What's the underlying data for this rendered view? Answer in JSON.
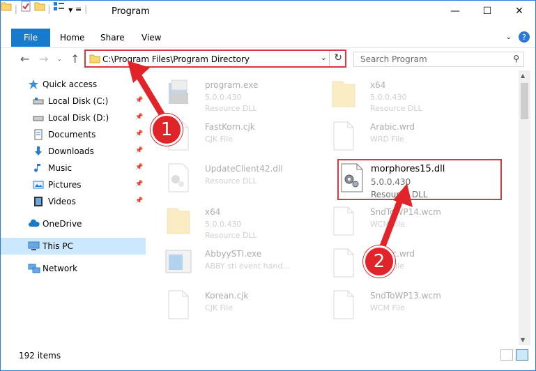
{
  "window": {
    "title": "Program"
  },
  "ribbon": {
    "tabs": [
      "File",
      "Home",
      "Share",
      "View"
    ]
  },
  "navbar": {
    "address_path": "C:\\Program Files\\Program Directory",
    "search_placeholder": "Search Program"
  },
  "sidebar": {
    "items": [
      {
        "label": "Quick access",
        "icon": "star-icon"
      },
      {
        "label": "Local Disk (C:)",
        "icon": "drive-icon"
      },
      {
        "label": "Local Disk (D:)",
        "icon": "drive-icon"
      },
      {
        "label": "Documents",
        "icon": "documents-icon"
      },
      {
        "label": "Downloads",
        "icon": "download-icon"
      },
      {
        "label": "Music",
        "icon": "music-icon"
      },
      {
        "label": "Pictures",
        "icon": "pictures-icon"
      },
      {
        "label": "Videos",
        "icon": "videos-icon"
      },
      {
        "label": "OneDrive",
        "icon": "cloud-icon"
      },
      {
        "label": "This PC",
        "icon": "computer-icon"
      },
      {
        "label": "Network",
        "icon": "network-icon"
      }
    ]
  },
  "files": [
    {
      "name": "program.exe",
      "line2": "5.0.0.430",
      "line3": "Resource DLL",
      "icon": "installer-icon"
    },
    {
      "name": "x64",
      "line2": "5.0.0.430",
      "line3": "Resource DLL",
      "icon": "folder-icon"
    },
    {
      "name": "FastKorn.cjk",
      "line2": "CJK File",
      "line3": "",
      "icon": "blank-file-icon"
    },
    {
      "name": "Arabic.wrd",
      "line2": "WRD File",
      "line3": "",
      "icon": "blank-file-icon"
    },
    {
      "name": "UpdateClient42.dll",
      "line2": "Resource DLL",
      "line3": "",
      "icon": "dll-gear-icon"
    },
    {
      "name": "morphores15.dll",
      "line2": "5.0.0.430",
      "line3": "Resource DLL",
      "icon": "dll-gear-icon"
    },
    {
      "name": "x64",
      "line2": "5.0.0.430",
      "line3": "Resource DLL",
      "icon": "folder-icon"
    },
    {
      "name": "SndToWP14.wcm",
      "line2": "WCM File",
      "line3": "",
      "icon": "blank-file-icon"
    },
    {
      "name": "AbbyySTI.exe",
      "line2": "ABBY sti event hand...",
      "line3": "",
      "icon": "app-window-icon"
    },
    {
      "name": "Arabic.wrd",
      "line2": "WRD File",
      "line3": "",
      "icon": "blank-file-icon"
    },
    {
      "name": "Korean.cjk",
      "line2": "CJK File",
      "line3": "",
      "icon": "blank-file-icon"
    },
    {
      "name": "SndToWP13.wcm",
      "line2": "WCM File",
      "line3": "",
      "icon": "blank-file-icon"
    }
  ],
  "status": {
    "item_count": "192 items"
  },
  "annotations": {
    "badge1": "1",
    "badge2": "2"
  },
  "colors": {
    "accent": "#1979ca",
    "annotation_red": "#e1242a",
    "selected_bg": "#cce8ff"
  }
}
